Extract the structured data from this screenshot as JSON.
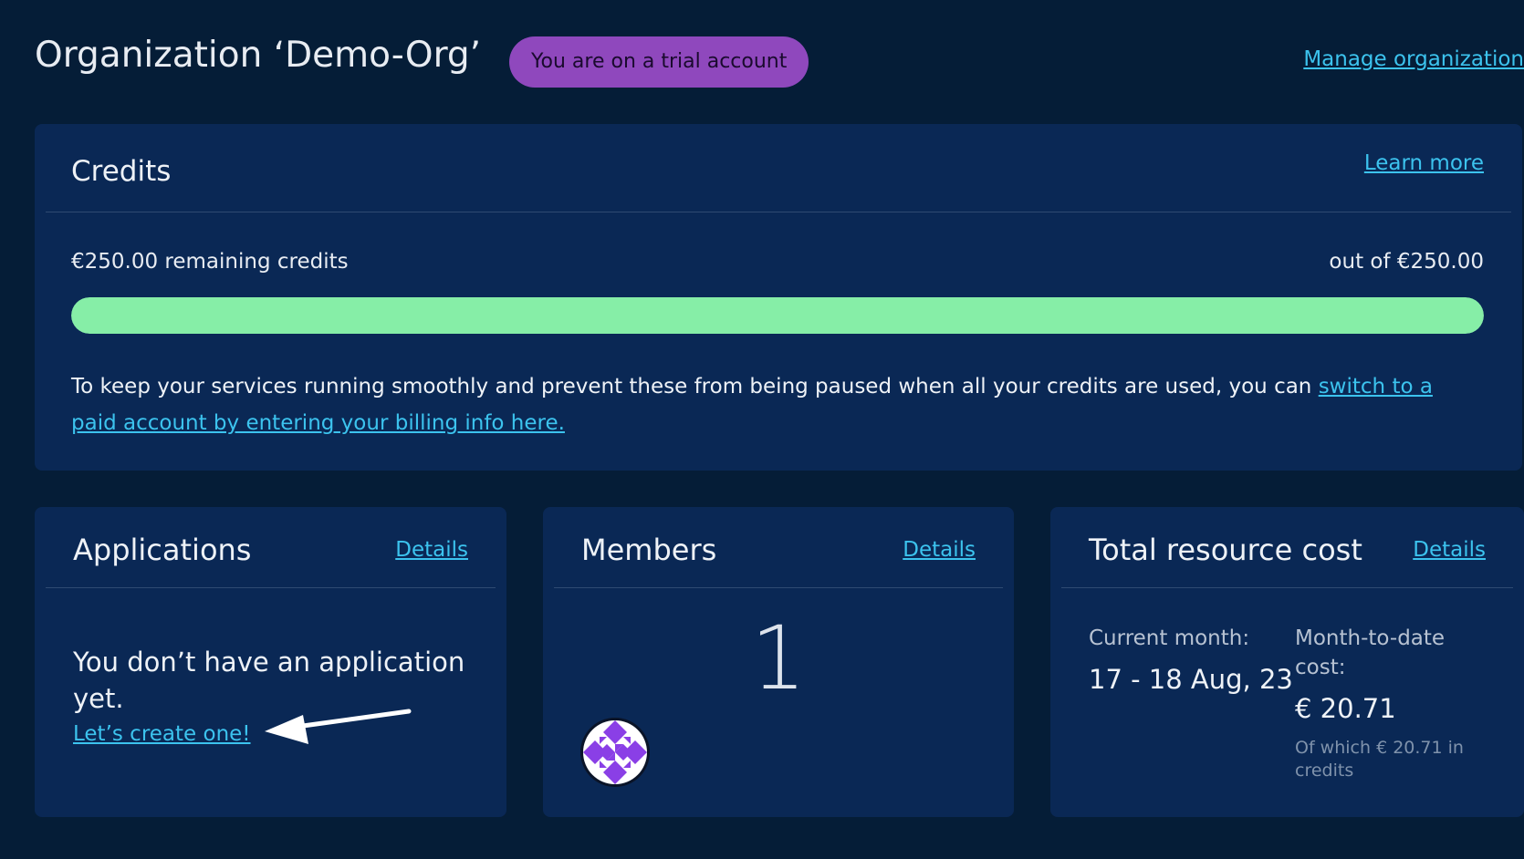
{
  "header": {
    "title": "Organization ‘Demo-Org’",
    "trial_badge": "You are on a trial account",
    "manage_link": "Manage organization"
  },
  "credits": {
    "title": "Credits",
    "learn_more": "Learn more",
    "remaining": "€250.00 remaining credits",
    "out_of": "out of €250.00",
    "fill_fraction": 1.0,
    "notice_text": "To keep your services running smoothly and prevent these from being paused when all your credits are used, you can ",
    "notice_link": "switch to a paid account by entering your billing info here."
  },
  "applications": {
    "title": "Applications",
    "details": "Details",
    "empty_text": "You don’t have an application yet.",
    "create_link": "Let’s create one!"
  },
  "members": {
    "title": "Members",
    "details": "Details",
    "count": "1"
  },
  "cost": {
    "title": "Total resource cost",
    "details": "Details",
    "current_month_label": "Current month:",
    "current_month_value": "17 - 18 Aug, 23",
    "mtd_label": "Month-to-date cost:",
    "mtd_value": "€ 20.71",
    "credit_note": "Of which € 20.71 in credits"
  },
  "colors": {
    "background": "#051d37",
    "card": "#0a2855",
    "accent_link": "#3cc3ee",
    "trial_badge": "#8f48bd",
    "progress_fill": "#86eea7"
  }
}
